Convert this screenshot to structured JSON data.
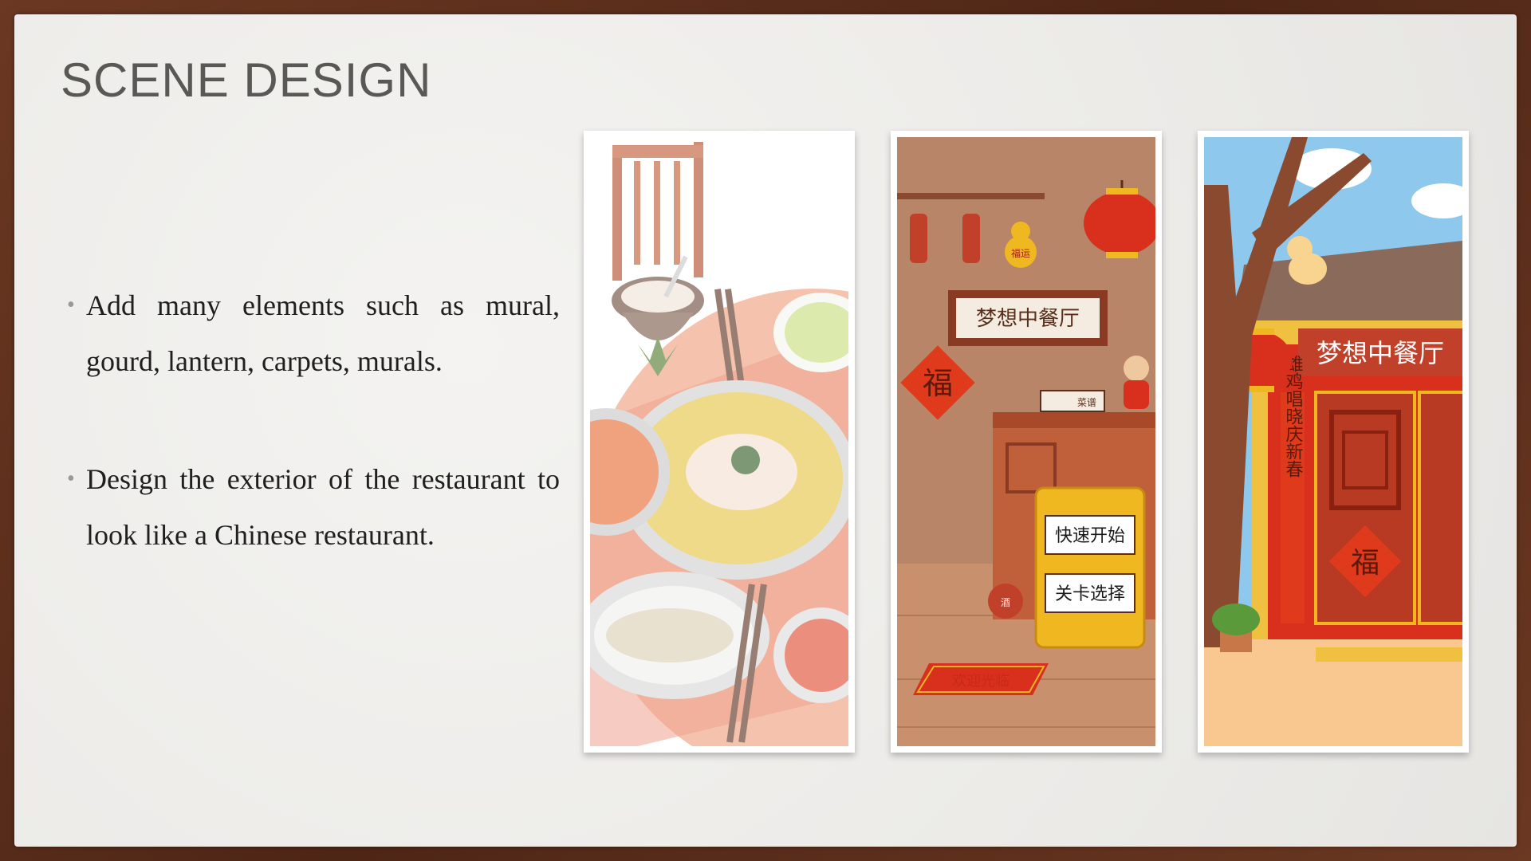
{
  "slide": {
    "title": "SCENE DESIGN",
    "bullets": [
      "Add many elements such as mural, gourd, lantern, carpets, murals.",
      "Design the exterior of the restaurant to look like a Chinese restaurant."
    ]
  },
  "illustrations": {
    "interior": {
      "sign": "梦想中餐厅",
      "fu": "福",
      "button_start": "快速开始",
      "button_levels": "关卡选择",
      "mat": "欢迎光临",
      "book": "菜谱",
      "gourd": "福运",
      "jar": "酒"
    },
    "exterior": {
      "sign": "梦想中餐厅",
      "couplet": "雄鸡唱晓庆新春",
      "fu": "福"
    }
  },
  "colors": {
    "frame": "#5a2e1c",
    "title": "#5a5854",
    "lantern_red": "#d8301c",
    "wall": "#b98568"
  }
}
